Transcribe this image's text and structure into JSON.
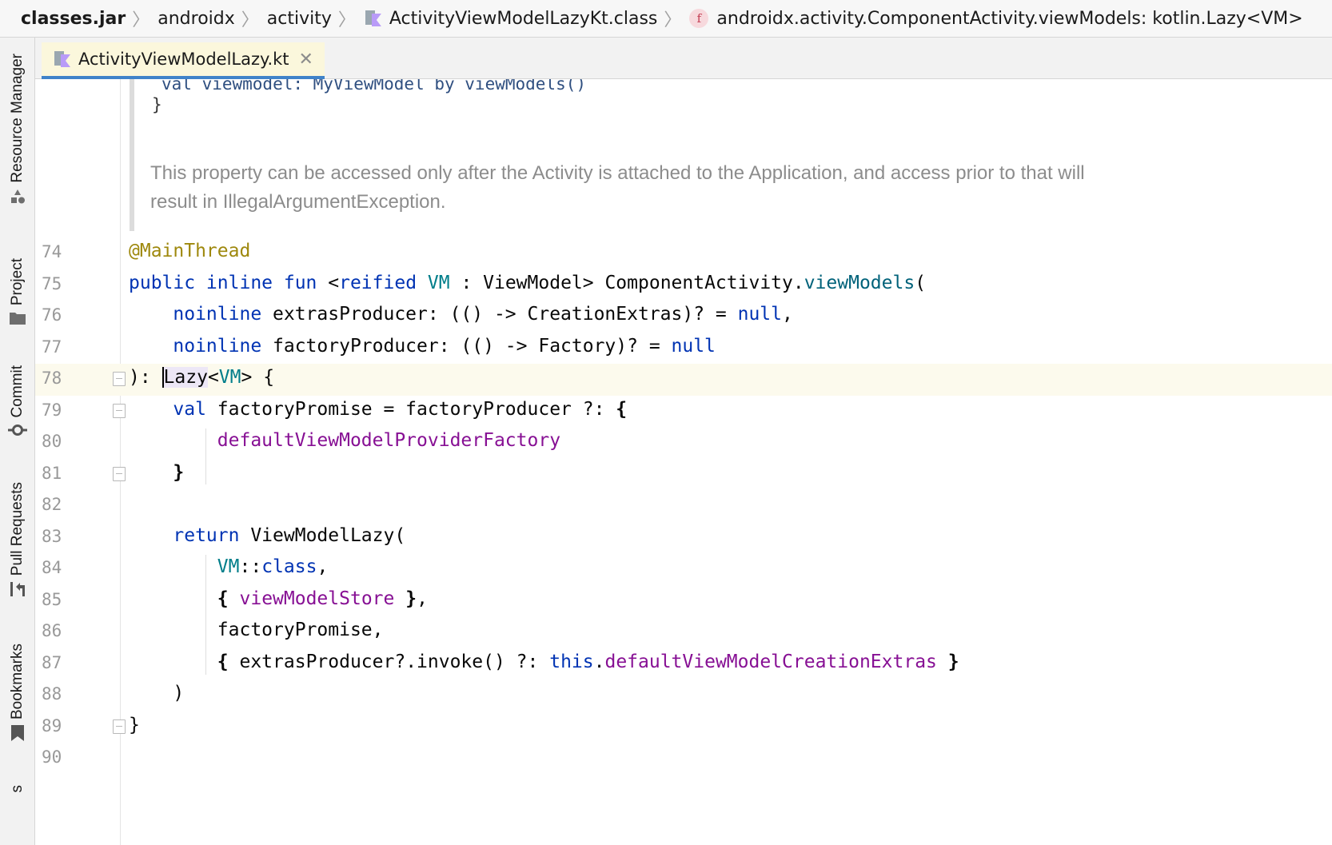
{
  "breadcrumb": {
    "items": [
      {
        "label": "classes.jar",
        "bold": true,
        "icon": ""
      },
      {
        "label": "androidx",
        "bold": false,
        "icon": ""
      },
      {
        "label": "activity",
        "bold": false,
        "icon": ""
      },
      {
        "label": "ActivityViewModelLazyKt.class",
        "bold": false,
        "icon": "kotlin-class-icon"
      },
      {
        "label": "androidx.activity.ComponentActivity.viewModels: kotlin.Lazy<VM>",
        "bold": false,
        "icon": "function-icon"
      }
    ],
    "function_icon_letter": "f"
  },
  "tool_windows": [
    {
      "label": "Resource Manager",
      "icon": "resource-manager-icon"
    },
    {
      "label": "Project",
      "icon": "folder-icon"
    },
    {
      "label": "Commit",
      "icon": "commit-icon"
    },
    {
      "label": "Pull Requests",
      "icon": "pull-request-icon"
    },
    {
      "label": "Bookmarks",
      "icon": "bookmark-icon"
    },
    {
      "label": "s",
      "icon": ""
    }
  ],
  "tab": {
    "label": "ActivityViewModelLazy.kt",
    "close": "✕"
  },
  "doc": {
    "code_line_1": "val viewmodel: MyViewModel by viewModels()",
    "code_line_2": "}",
    "text": "This property can be accessed only after the Activity is attached to the Application, and access prior to that will result in IllegalArgumentException."
  },
  "code_lines": [
    {
      "num": "74"
    },
    {
      "num": "75"
    },
    {
      "num": "76"
    },
    {
      "num": "77"
    },
    {
      "num": "78"
    },
    {
      "num": "79"
    },
    {
      "num": "80"
    },
    {
      "num": "81"
    },
    {
      "num": "82"
    },
    {
      "num": "83"
    },
    {
      "num": "84"
    },
    {
      "num": "85"
    },
    {
      "num": "86"
    },
    {
      "num": "87"
    },
    {
      "num": "88"
    },
    {
      "num": "89"
    },
    {
      "num": "90"
    }
  ],
  "colors": {
    "keyword": "#0033b3",
    "annotation": "#9e880d",
    "type_param": "#007e8a",
    "function": "#00627a",
    "property": "#871094",
    "tab_underline": "#4083c9",
    "current_line": "#fcfaed"
  }
}
